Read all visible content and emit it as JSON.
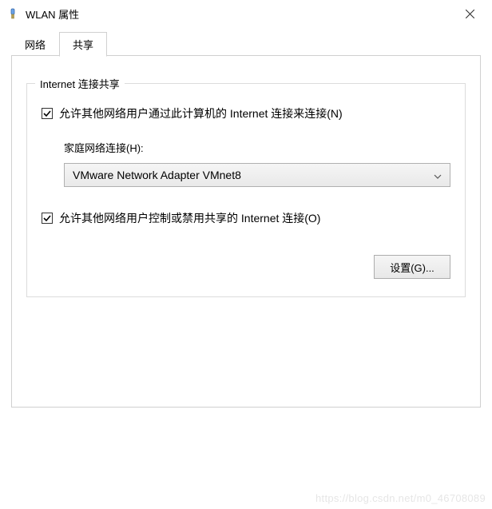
{
  "window": {
    "title": "WLAN 属性"
  },
  "tabs": {
    "network": "网络",
    "sharing": "共享"
  },
  "group": {
    "legend": "Internet 连接共享",
    "checkbox_allow_connect": "允许其他网络用户通过此计算机的 Internet 连接来连接(N)",
    "home_network_label": "家庭网络连接(H):",
    "home_network_value": "VMware Network Adapter VMnet8",
    "checkbox_allow_control": "允许其他网络用户控制或禁用共享的 Internet 连接(O)",
    "settings_button": "设置(G)..."
  },
  "watermark": "https://blog.csdn.net/m0_46708089"
}
